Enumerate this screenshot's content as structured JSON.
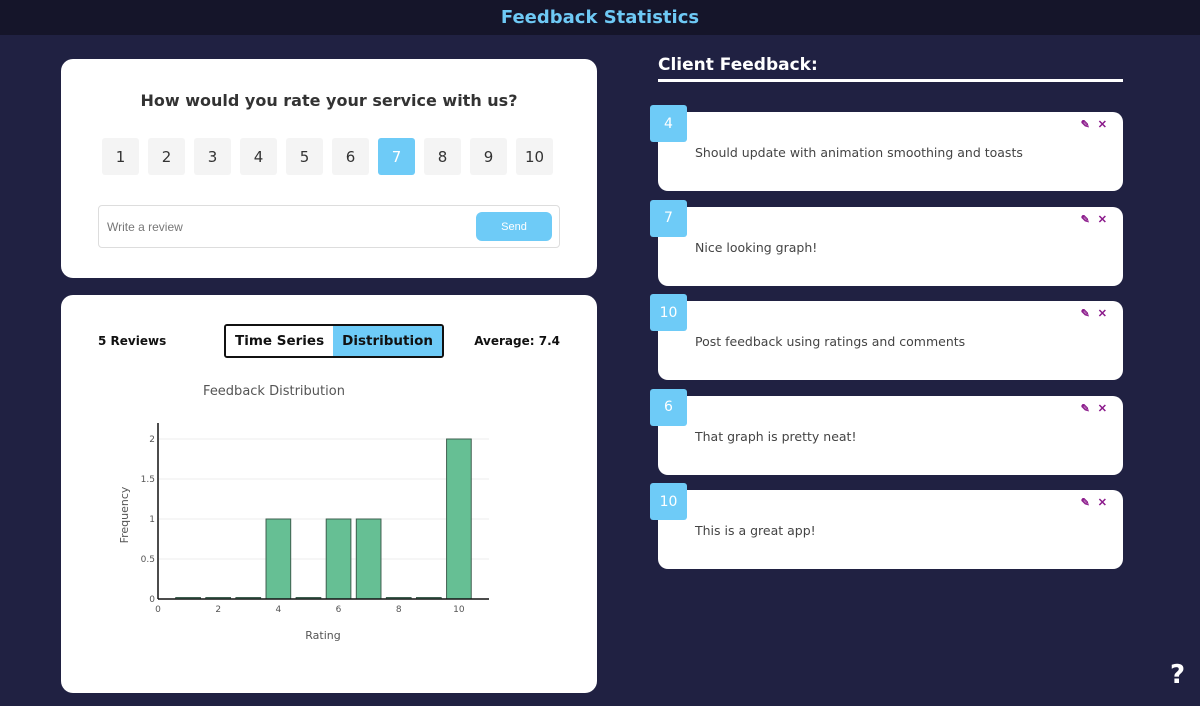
{
  "header": {
    "title": "Feedback Statistics"
  },
  "rating_form": {
    "question": "How would you rate your service with us?",
    "options": [
      "1",
      "2",
      "3",
      "4",
      "5",
      "6",
      "7",
      "8",
      "9",
      "10"
    ],
    "selected": "7",
    "review_placeholder": "Write a review",
    "review_value": "",
    "send_label": "Send"
  },
  "stats": {
    "review_count": "5 Reviews",
    "average": "Average: 7.4",
    "tabs": [
      "Time Series",
      "Distribution"
    ],
    "active_tab": "Distribution"
  },
  "chart_data": {
    "type": "bar",
    "title": "Feedback Distribution",
    "xlabel": "Rating",
    "ylabel": "Frequency",
    "categories": [
      1,
      2,
      3,
      4,
      5,
      6,
      7,
      8,
      9,
      10
    ],
    "values": [
      0,
      0,
      0,
      1,
      0,
      1,
      1,
      0,
      0,
      2
    ],
    "xlim": [
      0,
      11
    ],
    "ylim": [
      0,
      2.1
    ],
    "xticks": [
      0,
      2,
      4,
      6,
      8,
      10
    ],
    "yticks": [
      0,
      0.5,
      1,
      1.5,
      2
    ],
    "ytick_labels": [
      "0",
      "0.5",
      "1",
      "1.5",
      "2"
    ],
    "bar_color": "#66bf94",
    "grid": true
  },
  "feedback": {
    "title": "Client Feedback:",
    "items": [
      {
        "rating": "4",
        "text": "Should update with animation smoothing and toasts"
      },
      {
        "rating": "7",
        "text": "Nice looking graph!"
      },
      {
        "rating": "10",
        "text": "Post feedback using ratings and comments"
      },
      {
        "rating": "6",
        "text": "That graph is pretty neat!"
      },
      {
        "rating": "10",
        "text": "This is a great app!"
      }
    ],
    "edit_icon": "edit-icon",
    "delete_icon": "close-icon"
  },
  "help": {
    "label": "?"
  },
  "colors": {
    "accent": "#6ecbf7",
    "background": "#202142",
    "header_bg": "#15152a",
    "action_icons": "#8b1a8b"
  }
}
